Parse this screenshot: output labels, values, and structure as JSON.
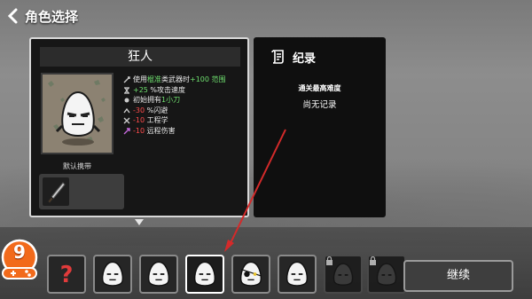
{
  "header": {
    "back_icon": "chevron-left-icon",
    "title": "角色选择"
  },
  "character": {
    "name": "狂人",
    "default_carry_label": "默认携带",
    "default_weapon_icon": "knife-icon",
    "stats": [
      {
        "icon": "weapon-icon",
        "text_parts": [
          {
            "t": "使用",
            "c": "n"
          },
          {
            "t": "棍准",
            "c": "g"
          },
          {
            "t": "类武器时",
            "c": "n"
          },
          {
            "t": "+100 范围",
            "c": "g"
          }
        ]
      },
      {
        "icon": "speed-icon",
        "text_parts": [
          {
            "t": "+25",
            "c": "g"
          },
          {
            "t": " %攻击速度",
            "c": "n"
          }
        ]
      },
      {
        "icon": "start-item-icon",
        "text_parts": [
          {
            "t": "初始拥有",
            "c": "n"
          },
          {
            "t": "1小刀",
            "c": "g"
          }
        ]
      },
      {
        "icon": "dodge-icon",
        "text_parts": [
          {
            "t": "-30",
            "c": "r"
          },
          {
            "t": " %闪避",
            "c": "n"
          }
        ]
      },
      {
        "icon": "engineering-icon",
        "text_parts": [
          {
            "t": "-10",
            "c": "r"
          },
          {
            "t": " 工程学",
            "c": "n"
          }
        ]
      },
      {
        "icon": "ranged-damage-icon",
        "text_parts": [
          {
            "t": "-10",
            "c": "r"
          },
          {
            "t": " 远程伤害",
            "c": "n"
          }
        ]
      }
    ]
  },
  "record": {
    "icon": "scroll-icon",
    "title": "纪录",
    "subtitle": "通关最高难度",
    "value": "尚无记录"
  },
  "character_list": [
    {
      "id": "random",
      "icon": "question-mark-icon",
      "locked": false,
      "selected": false
    },
    {
      "id": "char-1",
      "icon": "potato-face-icon",
      "locked": false,
      "selected": false
    },
    {
      "id": "char-2",
      "icon": "potato-face-icon",
      "locked": false,
      "selected": false
    },
    {
      "id": "char-3",
      "icon": "potato-face-icon",
      "locked": false,
      "selected": true
    },
    {
      "id": "char-4",
      "icon": "potato-pirate-icon",
      "locked": false,
      "selected": false
    },
    {
      "id": "char-5",
      "icon": "potato-face-icon",
      "locked": false,
      "selected": false
    },
    {
      "id": "char-6",
      "icon": "locked-character-icon",
      "locked": true,
      "selected": false
    },
    {
      "id": "char-7",
      "icon": "locked-character-icon",
      "locked": true,
      "selected": false
    }
  ],
  "continue_label": "继续",
  "logo": {
    "text": "9",
    "icon": "gamepad-logo-icon"
  },
  "colors": {
    "positive": "#6fe06f",
    "negative": "#ff4b4b",
    "panel_bg": "#161616",
    "arrow": "#d42a2a",
    "logo": "#f26a1b"
  }
}
